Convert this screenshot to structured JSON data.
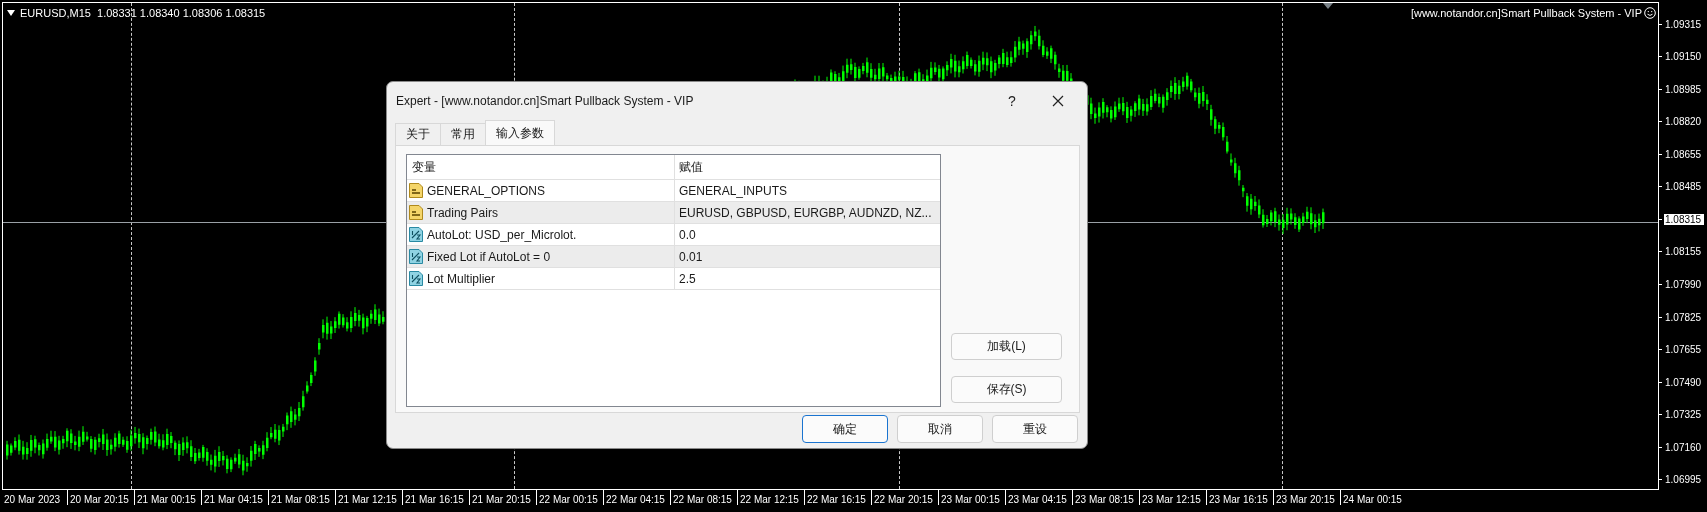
{
  "chart": {
    "header": "EURUSD,M15  1.08331 1.08340 1.08306 1.08315",
    "expert_label": "[www.notandor.cn]Smart Pullback System - VIP",
    "price_axis": [
      {
        "label": "1.09315",
        "current": false
      },
      {
        "label": "1.09150",
        "current": false
      },
      {
        "label": "1.08985",
        "current": false
      },
      {
        "label": "1.08820",
        "current": false
      },
      {
        "label": "1.08655",
        "current": false
      },
      {
        "label": "1.08485",
        "current": false
      },
      {
        "label": "1.08315",
        "current": true
      },
      {
        "label": "1.08155",
        "current": false
      },
      {
        "label": "1.07990",
        "current": false
      },
      {
        "label": "1.07825",
        "current": false
      },
      {
        "label": "1.07655",
        "current": false
      },
      {
        "label": "1.07490",
        "current": false
      },
      {
        "label": "1.07325",
        "current": false
      },
      {
        "label": "1.07160",
        "current": false
      },
      {
        "label": "1.06995",
        "current": false
      }
    ],
    "time_axis": [
      "20 Mar 2023",
      "20 Mar 20:15",
      "21 Mar 00:15",
      "21 Mar 04:15",
      "21 Mar 08:15",
      "21 Mar 12:15",
      "21 Mar 16:15",
      "21 Mar 20:15",
      "22 Mar 00:15",
      "22 Mar 04:15",
      "22 Mar 08:15",
      "22 Mar 12:15",
      "22 Mar 16:15",
      "22 Mar 20:15",
      "23 Mar 00:15",
      "23 Mar 04:15",
      "23 Mar 08:15",
      "23 Mar 12:15",
      "23 Mar 16:15",
      "23 Mar 20:15",
      "24 Mar 00:15"
    ]
  },
  "dialog": {
    "title": "Expert - [www.notandor.cn]Smart Pullback System - VIP",
    "help": "?",
    "tabs": [
      {
        "label": "关于",
        "selected": false
      },
      {
        "label": "常用",
        "selected": false
      },
      {
        "label": "输入参数",
        "selected": true
      }
    ],
    "table": {
      "columns": [
        "变量",
        "赋值"
      ],
      "rows": [
        {
          "kind": "string",
          "name": "GENERAL_OPTIONS",
          "value": "GENERAL_INPUTS"
        },
        {
          "kind": "string",
          "name": "Trading Pairs",
          "value": "EURUSD, GBPUSD, EURGBP, AUDNZD, NZ..."
        },
        {
          "kind": "number",
          "name": "AutoLot: USD_per_Microlot.",
          "value": "0.0"
        },
        {
          "kind": "number",
          "name": "Fixed Lot if AutoLot = 0",
          "value": "0.01"
        },
        {
          "kind": "number",
          "name": "Lot Multiplier",
          "value": "2.5"
        }
      ]
    },
    "side_buttons": [
      "加载(L)",
      "保存(S)"
    ],
    "buttons": [
      {
        "label": "确定",
        "default": true
      },
      {
        "label": "取消",
        "default": false
      },
      {
        "label": "重设",
        "default": false
      }
    ]
  }
}
